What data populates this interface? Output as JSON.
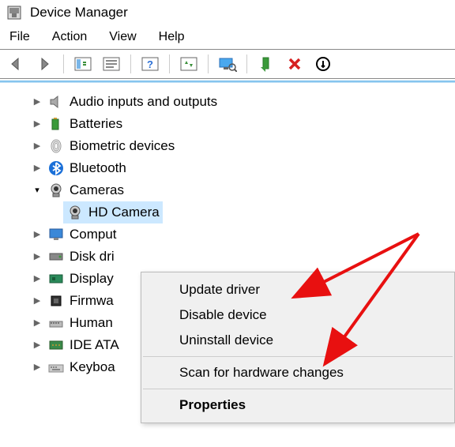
{
  "window": {
    "title": "Device Manager"
  },
  "menubar": [
    "File",
    "Action",
    "View",
    "Help"
  ],
  "tree": {
    "items": [
      {
        "label": "Audio inputs and outputs",
        "icon": "speaker",
        "expanded": false
      },
      {
        "label": "Batteries",
        "icon": "battery",
        "expanded": false
      },
      {
        "label": "Biometric devices",
        "icon": "fingerprint",
        "expanded": false
      },
      {
        "label": "Bluetooth",
        "icon": "bluetooth",
        "expanded": false
      },
      {
        "label": "Cameras",
        "icon": "camera",
        "expanded": true,
        "children": [
          {
            "label": "HD Camera",
            "icon": "camera",
            "selected": true
          }
        ]
      },
      {
        "label": "Comput",
        "icon": "monitor",
        "expanded": false
      },
      {
        "label": "Disk dri",
        "icon": "disk",
        "expanded": false
      },
      {
        "label": "Display",
        "icon": "display-adapter",
        "expanded": false
      },
      {
        "label": "Firmwa",
        "icon": "firmware",
        "expanded": false
      },
      {
        "label": "Human",
        "icon": "hid",
        "expanded": false
      },
      {
        "label": "IDE ATA",
        "icon": "ide",
        "expanded": false
      },
      {
        "label": "Keyboa",
        "icon": "keyboard",
        "expanded": false
      }
    ]
  },
  "context_menu": {
    "update_driver": "Update driver",
    "disable_device": "Disable device",
    "uninstall_device": "Uninstall device",
    "scan_hardware": "Scan for hardware changes",
    "properties": "Properties"
  }
}
